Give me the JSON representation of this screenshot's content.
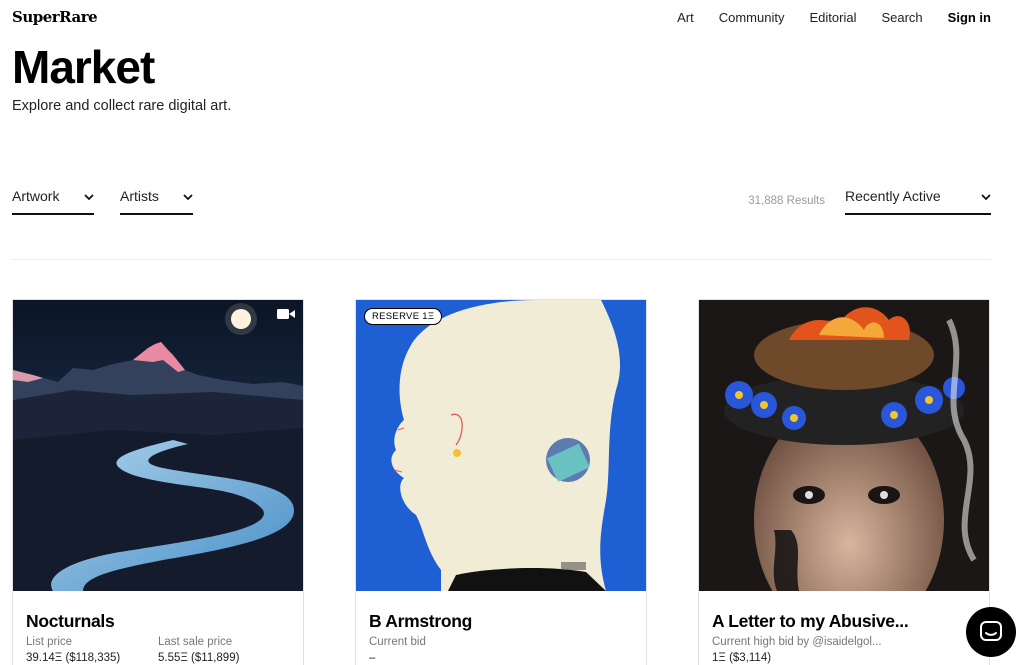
{
  "brand": {
    "logo_text": "SuperRare"
  },
  "nav": {
    "items": [
      {
        "label": "Art"
      },
      {
        "label": "Community"
      },
      {
        "label": "Editorial"
      },
      {
        "label": "Search"
      },
      {
        "label": "Sign in"
      }
    ]
  },
  "header": {
    "title": "Market",
    "subtitle": "Explore and collect rare digital art."
  },
  "filters": {
    "artwork_label": "Artwork",
    "artists_label": "Artists",
    "results_text": "31,888 Results",
    "sort_label": "Recently Active"
  },
  "cards": [
    {
      "title": "Nocturnals",
      "label1": "List price",
      "value1": "39.14Ξ ($118,335)",
      "label2": "Last sale price",
      "value2": "5.55Ξ ($11,899)",
      "media_icon": "video-camera-icon"
    },
    {
      "title": "B Armstrong",
      "badge": "RESERVE 1Ξ",
      "label1": "Current bid",
      "value1": "–"
    },
    {
      "title": "A Letter to my Abusive...",
      "label1": "Current high bid by @isaidelgol...",
      "value1": "1Ξ ($3,114)"
    }
  ],
  "chat": {
    "icon": "chat-bubble-icon"
  },
  "colors": {
    "background": "#ffffff",
    "text": "#111111",
    "muted": "#9a9a9a",
    "blue_art": "#1e5fd4",
    "cream": "#f1ecd5"
  }
}
